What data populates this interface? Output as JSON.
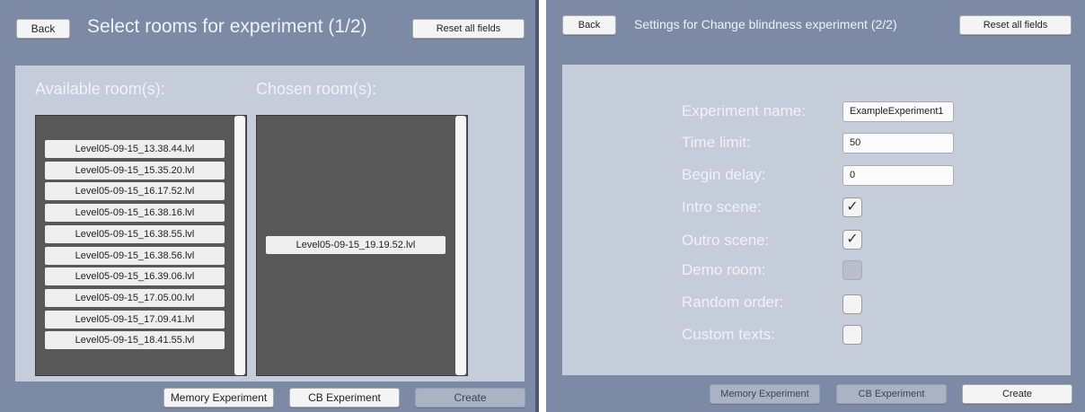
{
  "left": {
    "back_label": "Back",
    "title": "Select rooms for experiment (1/2)",
    "reset_label": "Reset all fields",
    "available_heading": "Available room(s):",
    "chosen_heading": "Chosen room(s):",
    "available_rooms": [
      "Level05-09-15_13.38.44.lvl",
      "Level05-09-15_15.35.20.lvl",
      "Level05-09-15_16.17.52.lvl",
      "Level05-09-15_16.38.16.lvl",
      "Level05-09-15_16.38.55.lvl",
      "Level05-09-15_16.38.56.lvl",
      "Level05-09-15_16.39.06.lvl",
      "Level05-09-15_17.05.00.lvl",
      "Level05-09-15_17.09.41.lvl",
      "Level05-09-15_18.41.55.lvl"
    ],
    "chosen_rooms": [
      "Level05-09-15_19.19.52.lvl"
    ],
    "memory_label": "Memory Experiment",
    "cb_label": "CB Experiment",
    "create_label": "Create"
  },
  "right": {
    "back_label": "Back",
    "title": "Settings for Change blindness experiment (2/2)",
    "reset_label": "Reset all fields",
    "fields": {
      "experiment_name": {
        "label": "Experiment name:",
        "value": "ExampleExperiment1"
      },
      "time_limit": {
        "label": "Time limit:",
        "value": "50"
      },
      "begin_delay": {
        "label": "Begin delay:",
        "value": "0"
      }
    },
    "checks": {
      "intro_scene": {
        "label": "Intro scene:",
        "checked": true,
        "enabled": true
      },
      "outro_scene": {
        "label": "Outro scene:",
        "checked": true,
        "enabled": true
      },
      "demo_room": {
        "label": "Demo room:",
        "checked": false,
        "enabled": false
      },
      "random_order": {
        "label": "Random order:",
        "checked": false,
        "enabled": true
      },
      "custom_texts": {
        "label": "Custom texts:",
        "checked": false,
        "enabled": true
      }
    },
    "memory_label": "Memory Experiment",
    "cb_label": "CB Experiment",
    "create_label": "Create"
  },
  "check_glyph": "✓",
  "colors": {
    "panel_bg": "#7c8aa5",
    "content_bg": "#c5ccda",
    "list_bg": "#585858",
    "button_bg": "#f4f4f4",
    "button_disabled_bg": "#a9b3c3"
  }
}
